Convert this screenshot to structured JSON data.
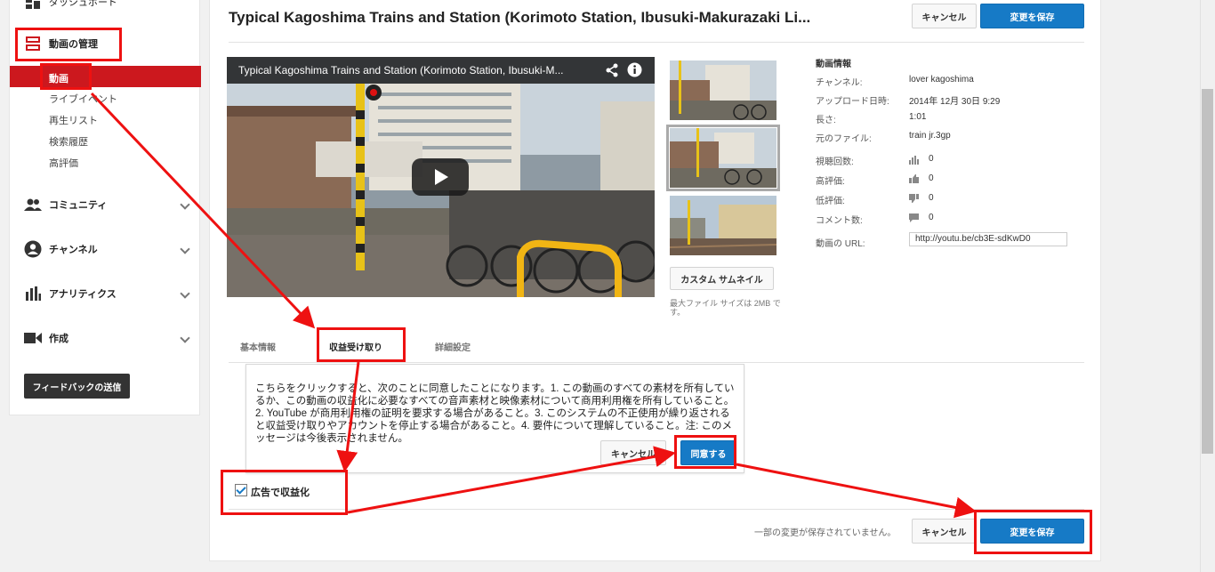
{
  "sidebar": {
    "top_cut_label": "ダッシュボード",
    "manage_label": "動画の管理",
    "sub_items": [
      "動画",
      "ライブイベント",
      "再生リスト",
      "検索履歴",
      "高評価"
    ],
    "community_label": "コミュニティ",
    "channel_label": "チャンネル",
    "analytics_label": "アナリティクス",
    "create_label": "作成",
    "feedback_label": "フィードバックの送信"
  },
  "header": {
    "title": "Typical Kagoshima Trains and Station (Korimoto Station, Ibusuki-Makurazaki Li...",
    "cancel_label": "キャンセル",
    "save_label": "変更を保存"
  },
  "player": {
    "title": "Typical Kagoshima Trains and Station (Korimoto Station, Ibusuki-M..."
  },
  "thumbnails": {
    "custom_label": "カスタム サムネイル",
    "max_size": "最大ファイル サイズは 2MB です。"
  },
  "info": {
    "heading": "動画情報",
    "channel_label": "チャンネル:",
    "channel_value": "lover kagoshima",
    "uploaded_label": "アップロード日時:",
    "uploaded_value": "2014年 12月 30日 9:29",
    "length_label": "長さ:",
    "length_value": "1:01",
    "file_label": "元のファイル:",
    "file_value": "train jr.3gp",
    "views_label": "視聴回数:",
    "views_value": "0",
    "likes_label": "高評価:",
    "likes_value": "0",
    "dislikes_label": "低評価:",
    "dislikes_value": "0",
    "comments_label": "コメント数:",
    "comments_value": "0",
    "url_label": "動画の URL:",
    "url_value": "http://youtu.be/cb3E-sdKwD0"
  },
  "tabs": [
    "基本情報",
    "収益受け取り",
    "詳細設定"
  ],
  "dialog": {
    "text": "こちらをクリックすると、次のことに同意したことになります。1. この動画のすべての素材を所有しているか、この動画の収益化に必要なすべての音声素材と映像素材について商用利用権を所有していること。2. YouTube が商用利用権の証明を要求する場合があること。3. このシステムの不正使用が繰り返されると収益受け取りやアカウントを停止する場合があること。4. 要件について理解していること。注: このメッセージは今後表示されません。",
    "cancel_label": "キャンセル",
    "agree_label": "同意する"
  },
  "monetize": {
    "label": "広告で収益化",
    "checked": true
  },
  "footer": {
    "unsaved_text": "一部の変更が保存されていません。",
    "cancel_label": "キャンセル",
    "save_label": "変更を保存"
  },
  "colors": {
    "accent_red": "#cc181e",
    "button_blue": "#167ac6",
    "annotation_red": "#ee1111"
  }
}
